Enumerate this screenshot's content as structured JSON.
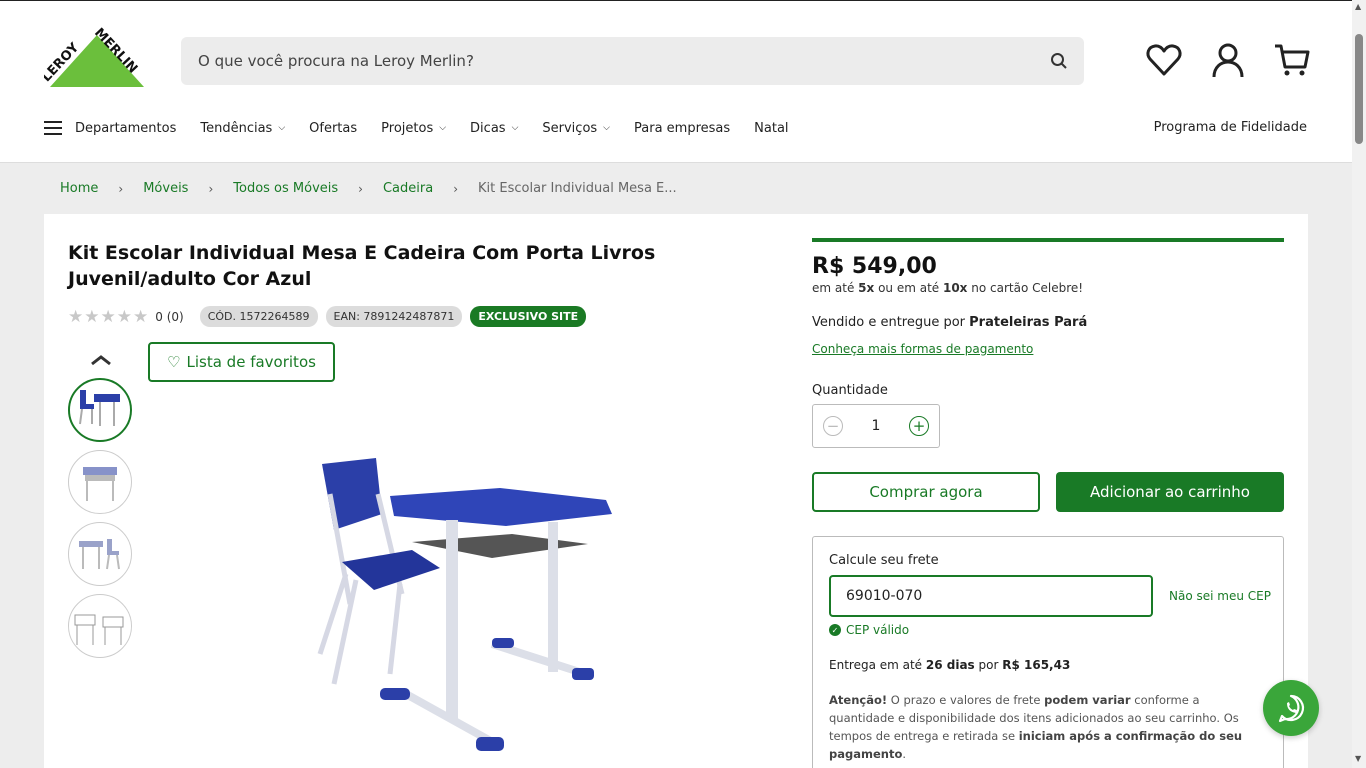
{
  "header": {
    "logo_text": "LEROY MERLIN",
    "search_placeholder": "O que você procura na Leroy Merlin?",
    "nav": [
      {
        "label": "Departamentos",
        "has_dropdown": false
      },
      {
        "label": "Tendências",
        "has_dropdown": true
      },
      {
        "label": "Ofertas",
        "has_dropdown": false
      },
      {
        "label": "Projetos",
        "has_dropdown": true
      },
      {
        "label": "Dicas",
        "has_dropdown": true
      },
      {
        "label": "Serviços",
        "has_dropdown": true
      },
      {
        "label": "Para empresas",
        "has_dropdown": false
      },
      {
        "label": "Natal",
        "has_dropdown": false
      }
    ],
    "loyalty": "Programa de Fidelidade"
  },
  "breadcrumb": [
    "Home",
    "Móveis",
    "Todos os Móveis",
    "Cadeira"
  ],
  "breadcrumb_current": "Kit Escolar Individual Mesa E...",
  "product": {
    "title": "Kit Escolar Individual Mesa E Cadeira Com Porta Livros Juvenil/adulto Cor Azul",
    "rating_count": "0 (0)",
    "rating_stars": 0,
    "code": "CÓD. 1572264589",
    "ean": "EAN: 7891242487871",
    "exclusive": "EXCLUSIVO SITE",
    "favorites": "Lista de favoritos",
    "price": "R$ 549,00",
    "installments_pre": "em até ",
    "installments_a": "5x",
    "installments_mid": " ou em até ",
    "installments_b": "10x",
    "installments_post": " no cartão Celebre!",
    "sold_by_pre": "Vendido e entregue por ",
    "sold_by": "Prateleiras Pará",
    "payment_link": "Conheça mais formas de pagamento",
    "quantity_label": "Quantidade",
    "quantity": "1",
    "buy_now": "Comprar agora",
    "add_to_cart": "Adicionar ao carrinho"
  },
  "shipping": {
    "label": "Calcule seu frete",
    "cep": "69010-070",
    "no_cep": "Não sei meu CEP",
    "valid": "CEP válido",
    "delivery_pre": "Entrega em até ",
    "delivery_days": "26 dias",
    "delivery_mid": " por ",
    "delivery_price": "R$ 165,43",
    "warning_bold1": "Atenção!",
    "warning_t1": " O prazo e valores de frete ",
    "warning_bold2": "podem variar",
    "warning_t2": " conforme a quantidade e disponibilidade dos itens adicionados ao seu carrinho. Os tempos de entrega e retirada se ",
    "warning_bold3": "iniciam após a confirmação do seu pagamento",
    "warning_t3": "."
  },
  "colors": {
    "brand_green": "#197a26",
    "logo_green": "#6bbf3c",
    "product_blue": "#2b3fa8",
    "whatsapp": "#3aa63a"
  },
  "icons": [
    "search-icon",
    "heart-icon",
    "user-icon",
    "cart-icon",
    "chevron-up-icon",
    "whatsapp-icon",
    "check-icon"
  ]
}
